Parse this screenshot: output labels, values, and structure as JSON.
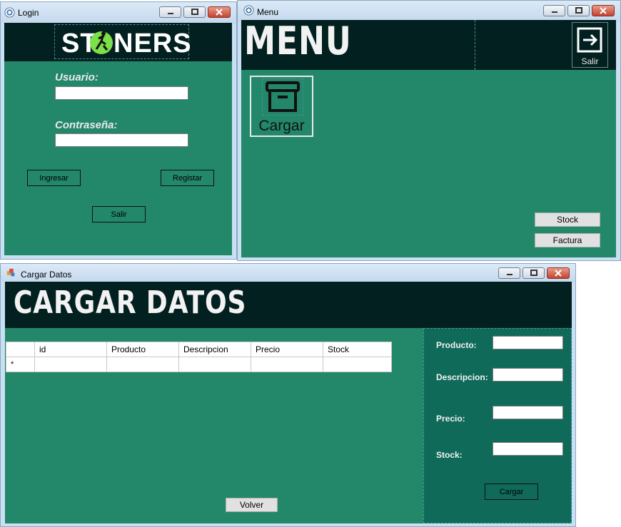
{
  "login": {
    "title": "Login",
    "logo": "ST NERS",
    "user_label": "Usuario:",
    "pass_label": "Contraseña:",
    "user_value": "",
    "pass_value": "",
    "ingresar": "Ingresar",
    "registar": "Registar",
    "salir": "Salir"
  },
  "menu": {
    "title": "Menu",
    "heading": "MENU",
    "salir": "Salir",
    "cargar": "Cargar",
    "stock": "Stock",
    "factura": "Factura"
  },
  "cargar_datos": {
    "title": "Cargar Datos",
    "heading": "CARGAR DATOS",
    "columns": [
      "id",
      "Producto",
      "Descripcion",
      "Precio",
      "Stock"
    ],
    "new_row_marker": "*",
    "producto_label": "Producto:",
    "descripcion_label": "Descripcion:",
    "precio_label": "Precio:",
    "stock_label": "Stock:",
    "cargar": "Cargar",
    "volver": "Volver"
  },
  "colors": {
    "panel": "#23876a",
    "header": "#032020",
    "side_panel": "#0f6a5a"
  }
}
